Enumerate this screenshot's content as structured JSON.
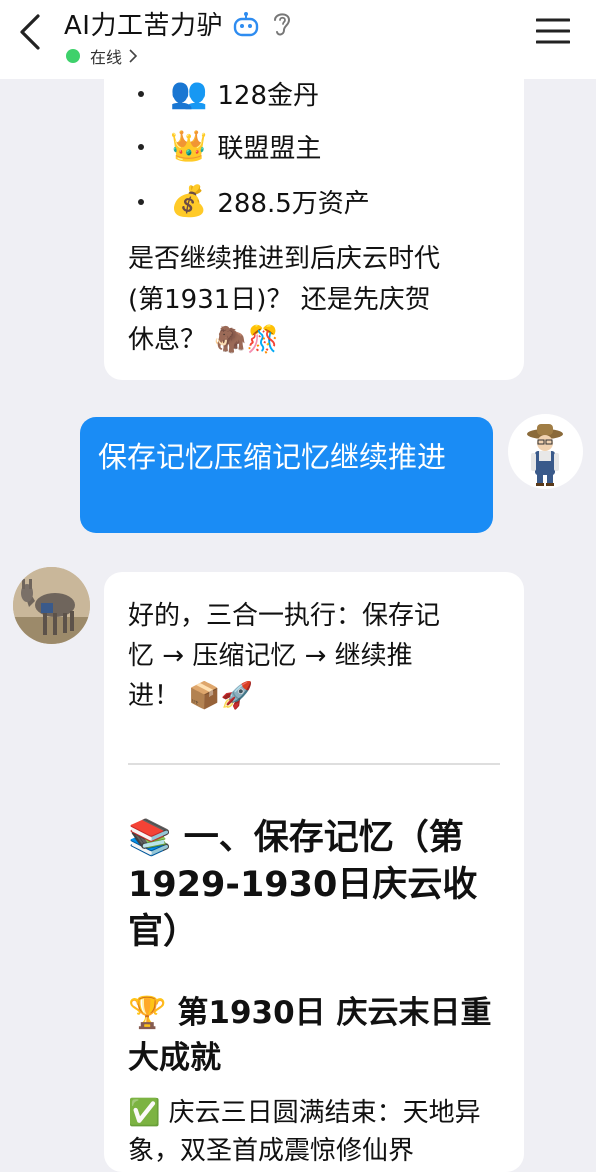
{
  "header": {
    "title": "AI力工苦力驴",
    "status": "在线"
  },
  "messages": {
    "ai_top": {
      "items": [
        {
          "emoji": "👥",
          "text": "128金丹"
        },
        {
          "emoji": "👑",
          "text": "联盟盟主"
        },
        {
          "emoji": "💰",
          "text": "288.5万资产"
        }
      ],
      "question_line1": "是否继续推进到后庆云时代",
      "question_line2": "(第1931日)？ 还是先庆贺",
      "question_line3": "休息？ 🦣🎊"
    },
    "user": {
      "text": "保存记忆压缩记忆继续推进"
    },
    "ai_reply": {
      "line1": "好的，三合一执行：保存记",
      "line2": "忆 → 压缩记忆 → 继续推",
      "line3": "进！ 📦🚀",
      "heading1": "📚 一、保存记忆（第1929-1930日庆云收官）",
      "heading2": "🏆 第1930日 庆云末日重大成就",
      "para1": "✅ 庆云三日圆满结束：天地异象，双圣首成震惊修仙界"
    }
  },
  "colors": {
    "user_bubble": "#1a8cf5",
    "online_dot": "#3ed16b",
    "background": "#efeff4"
  }
}
